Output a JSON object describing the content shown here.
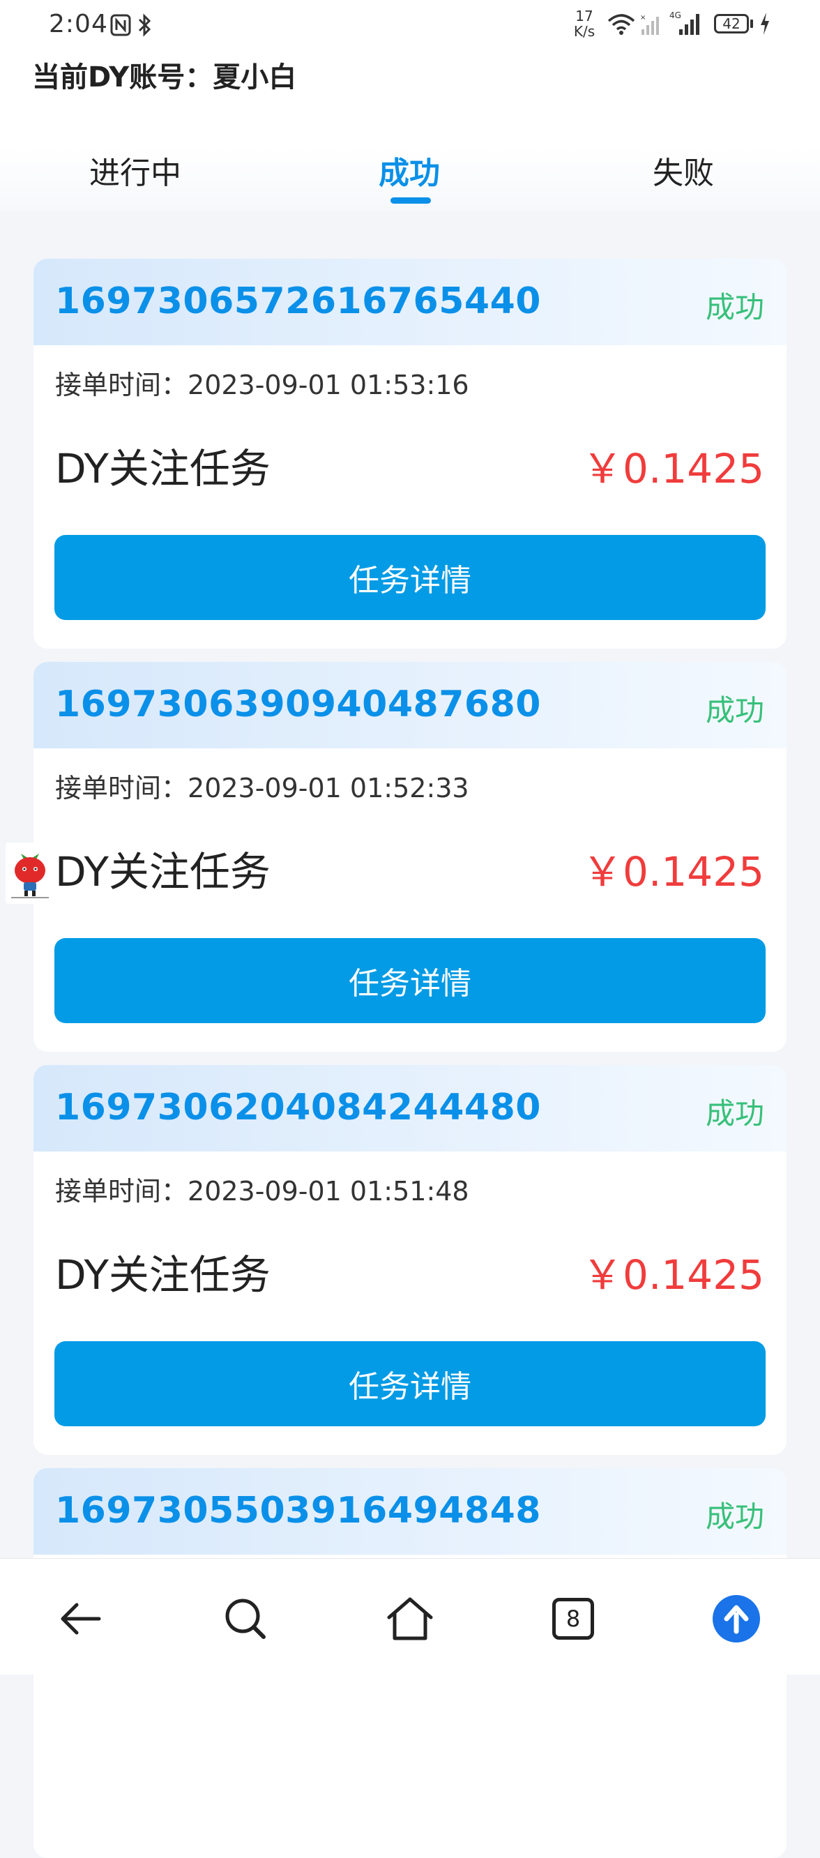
{
  "status_bar": {
    "time": "2:04",
    "net_speed_value": "17",
    "net_speed_unit": "K/s",
    "network": "4G",
    "battery": "42"
  },
  "account": {
    "label": "当前DY账号：",
    "name": "夏小白"
  },
  "tabs": [
    {
      "label": "进行中",
      "active": false
    },
    {
      "label": "成功",
      "active": true
    },
    {
      "label": "失败",
      "active": false
    }
  ],
  "time_label": "接单时间：",
  "orders": [
    {
      "id": "1697306572616765440",
      "status": "成功",
      "time": "2023-09-01 01:53:16",
      "task": "DY关注任务",
      "price": "￥0.1425",
      "button": "任务详情"
    },
    {
      "id": "1697306390940487680",
      "status": "成功",
      "time": "2023-09-01 01:52:33",
      "task": "DY关注任务",
      "price": "￥0.1425",
      "button": "任务详情"
    },
    {
      "id": "1697306204084244480",
      "status": "成功",
      "time": "2023-09-01 01:51:48",
      "task": "DY关注任务",
      "price": "￥0.1425",
      "button": "任务详情"
    },
    {
      "id": "1697305503916494848",
      "status": "成功"
    }
  ],
  "bottom_nav": {
    "tab_count": "8",
    "icons": [
      "back-arrow-icon",
      "search-icon",
      "home-icon",
      "tabs-icon",
      "upload-icon"
    ]
  },
  "colors": {
    "accent": "#0a90e8",
    "button": "#039be5",
    "success": "#37c07a",
    "price": "#f03c3c"
  }
}
